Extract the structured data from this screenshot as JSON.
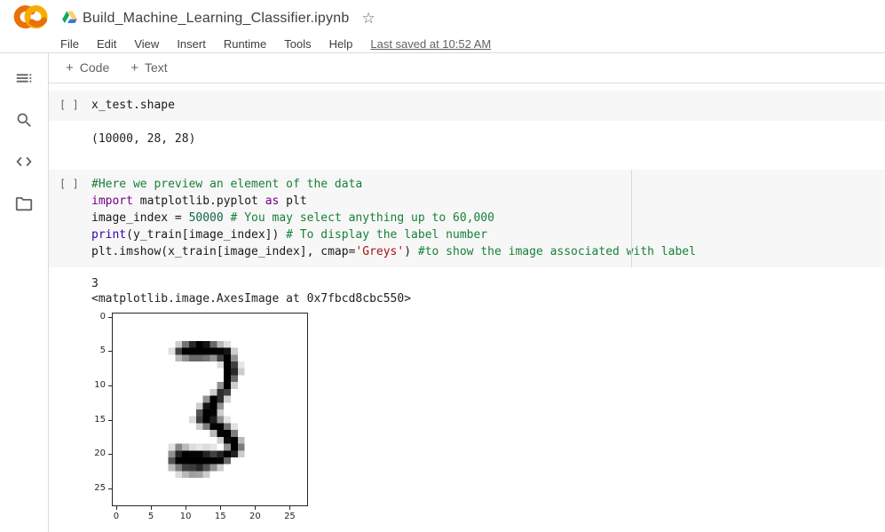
{
  "header": {
    "title": "Build_Machine_Learning_Classifier.ipynb",
    "star_icon": "☆",
    "menu_items": [
      "File",
      "Edit",
      "View",
      "Insert",
      "Runtime",
      "Tools",
      "Help"
    ],
    "last_saved": "Last saved at 10:52 AM"
  },
  "toolbar": {
    "add_code_label": "Code",
    "add_text_label": "Text",
    "plus": "+"
  },
  "sidebar": {
    "icons": [
      "table-of-contents-icon",
      "search-icon",
      "code-snippets-icon",
      "files-icon"
    ]
  },
  "cells": [
    {
      "gutter": "[ ]",
      "code_lines": [
        [
          [
            "pl",
            "x_test.shape"
          ]
        ]
      ],
      "output_lines": [
        "(10000, 28, 28)"
      ]
    },
    {
      "gutter": "[ ]",
      "code_lines": [
        [
          [
            "com",
            "#Here we preview an element of the data"
          ]
        ],
        [
          [
            "kw",
            "import"
          ],
          [
            "pl",
            " matplotlib.pyplot "
          ],
          [
            "kw",
            "as"
          ],
          [
            "pl",
            " plt"
          ]
        ],
        [
          [
            "pl",
            "image_index = "
          ],
          [
            "num",
            "50000"
          ],
          [
            "pl",
            " "
          ],
          [
            "com",
            "# You may select anything up to 60,000"
          ]
        ],
        [
          [
            "blt",
            "print"
          ],
          [
            "pl",
            "(y_train[image_index]) "
          ],
          [
            "com",
            "# To display the label number"
          ]
        ],
        [
          [
            "pl",
            "plt.imshow(x_train[image_index], cmap="
          ],
          [
            "str",
            "'Greys'"
          ],
          [
            "pl",
            ") "
          ],
          [
            "com",
            "#to show the image associated with label"
          ]
        ]
      ],
      "output_lines": [
        "3",
        "<matplotlib.image.AxesImage at 0x7fbcd8cbc550>"
      ]
    }
  ],
  "chart_data": {
    "type": "heatmap",
    "title": "",
    "xlabel": "",
    "ylabel": "",
    "colormap": "Greys",
    "x_ticks": [
      0,
      5,
      10,
      15,
      20,
      25
    ],
    "y_ticks": [
      0,
      5,
      10,
      15,
      20,
      25
    ],
    "xlim": [
      -0.5,
      27.5
    ],
    "ylim": [
      27.5,
      -0.5
    ],
    "description": "28x28 MNIST digit with label 3; values are darkness 0-255",
    "grid": [
      [
        0,
        0,
        0,
        0,
        0,
        0,
        0,
        0,
        0,
        0,
        0,
        0,
        0,
        0,
        0,
        0,
        0,
        0,
        0,
        0,
        0,
        0,
        0,
        0,
        0,
        0,
        0,
        0
      ],
      [
        0,
        0,
        0,
        0,
        0,
        0,
        0,
        0,
        0,
        0,
        0,
        0,
        0,
        0,
        0,
        0,
        0,
        0,
        0,
        0,
        0,
        0,
        0,
        0,
        0,
        0,
        0,
        0
      ],
      [
        0,
        0,
        0,
        0,
        0,
        0,
        0,
        0,
        0,
        0,
        0,
        0,
        0,
        0,
        0,
        0,
        0,
        0,
        0,
        0,
        0,
        0,
        0,
        0,
        0,
        0,
        0,
        0
      ],
      [
        0,
        0,
        0,
        0,
        0,
        0,
        0,
        0,
        0,
        0,
        0,
        0,
        0,
        0,
        0,
        0,
        0,
        0,
        0,
        0,
        0,
        0,
        0,
        0,
        0,
        0,
        0,
        0
      ],
      [
        0,
        0,
        0,
        0,
        0,
        0,
        0,
        0,
        0,
        50,
        140,
        215,
        255,
        235,
        150,
        70,
        30,
        0,
        0,
        0,
        0,
        0,
        0,
        0,
        0,
        0,
        0,
        0
      ],
      [
        0,
        0,
        0,
        0,
        0,
        0,
        0,
        0,
        30,
        190,
        255,
        255,
        255,
        255,
        255,
        250,
        235,
        50,
        0,
        0,
        0,
        0,
        0,
        0,
        0,
        0,
        0,
        0
      ],
      [
        0,
        0,
        0,
        0,
        0,
        0,
        0,
        0,
        0,
        70,
        110,
        150,
        150,
        140,
        110,
        190,
        255,
        110,
        0,
        0,
        0,
        0,
        0,
        0,
        0,
        0,
        0,
        0
      ],
      [
        0,
        0,
        0,
        0,
        0,
        0,
        0,
        0,
        0,
        0,
        0,
        0,
        0,
        0,
        0,
        35,
        255,
        190,
        25,
        0,
        0,
        0,
        0,
        0,
        0,
        0,
        0,
        0
      ],
      [
        0,
        0,
        0,
        0,
        0,
        0,
        0,
        0,
        0,
        0,
        0,
        0,
        0,
        0,
        0,
        0,
        255,
        215,
        50,
        0,
        0,
        0,
        0,
        0,
        0,
        0,
        0,
        0
      ],
      [
        0,
        0,
        0,
        0,
        0,
        0,
        0,
        0,
        0,
        0,
        0,
        0,
        0,
        0,
        0,
        0,
        255,
        150,
        0,
        0,
        0,
        0,
        0,
        0,
        0,
        0,
        0,
        0
      ],
      [
        0,
        0,
        0,
        0,
        0,
        0,
        0,
        0,
        0,
        0,
        0,
        0,
        0,
        0,
        0,
        110,
        255,
        50,
        0,
        0,
        0,
        0,
        0,
        0,
        0,
        0,
        0,
        0
      ],
      [
        0,
        0,
        0,
        0,
        0,
        0,
        0,
        0,
        0,
        0,
        0,
        0,
        0,
        0,
        50,
        210,
        190,
        0,
        0,
        0,
        0,
        0,
        0,
        0,
        0,
        0,
        0,
        0
      ],
      [
        0,
        0,
        0,
        0,
        0,
        0,
        0,
        0,
        0,
        0,
        0,
        0,
        0,
        110,
        255,
        210,
        45,
        0,
        0,
        0,
        0,
        0,
        0,
        0,
        0,
        0,
        0,
        0
      ],
      [
        0,
        0,
        0,
        0,
        0,
        0,
        0,
        0,
        0,
        0,
        0,
        0,
        50,
        235,
        255,
        110,
        0,
        0,
        0,
        0,
        0,
        0,
        0,
        0,
        0,
        0,
        0,
        0
      ],
      [
        0,
        0,
        0,
        0,
        0,
        0,
        0,
        0,
        0,
        0,
        0,
        0,
        170,
        255,
        250,
        50,
        0,
        0,
        0,
        0,
        0,
        0,
        0,
        0,
        0,
        0,
        0,
        0
      ],
      [
        0,
        0,
        0,
        0,
        0,
        0,
        0,
        0,
        0,
        0,
        0,
        35,
        190,
        255,
        225,
        110,
        25,
        0,
        0,
        0,
        0,
        0,
        0,
        0,
        0,
        0,
        0,
        0
      ],
      [
        0,
        0,
        0,
        0,
        0,
        0,
        0,
        0,
        0,
        0,
        0,
        0,
        50,
        130,
        250,
        255,
        140,
        30,
        0,
        0,
        0,
        0,
        0,
        0,
        0,
        0,
        0,
        0
      ],
      [
        0,
        0,
        0,
        0,
        0,
        0,
        0,
        0,
        0,
        0,
        0,
        0,
        0,
        0,
        70,
        250,
        255,
        130,
        0,
        0,
        0,
        0,
        0,
        0,
        0,
        0,
        0,
        0
      ],
      [
        0,
        0,
        0,
        0,
        0,
        0,
        0,
        0,
        0,
        0,
        0,
        0,
        0,
        0,
        0,
        50,
        245,
        255,
        70,
        0,
        0,
        0,
        0,
        0,
        0,
        0,
        0,
        0
      ],
      [
        0,
        0,
        0,
        0,
        0,
        0,
        0,
        0,
        30,
        120,
        70,
        35,
        25,
        35,
        25,
        0,
        110,
        255,
        130,
        0,
        0,
        0,
        0,
        0,
        0,
        0,
        0,
        0
      ],
      [
        0,
        0,
        0,
        0,
        0,
        0,
        0,
        0,
        110,
        220,
        255,
        250,
        250,
        220,
        190,
        220,
        255,
        220,
        50,
        0,
        0,
        0,
        0,
        0,
        0,
        0,
        0,
        0
      ],
      [
        0,
        0,
        0,
        0,
        0,
        0,
        0,
        0,
        170,
        255,
        255,
        255,
        255,
        255,
        255,
        250,
        150,
        0,
        0,
        0,
        0,
        0,
        0,
        0,
        0,
        0,
        0,
        0
      ],
      [
        0,
        0,
        0,
        0,
        0,
        0,
        0,
        0,
        70,
        130,
        190,
        195,
        215,
        170,
        110,
        50,
        0,
        0,
        0,
        0,
        0,
        0,
        0,
        0,
        0,
        0,
        0,
        0
      ],
      [
        0,
        0,
        0,
        0,
        0,
        0,
        0,
        0,
        0,
        35,
        70,
        95,
        90,
        50,
        0,
        0,
        0,
        0,
        0,
        0,
        0,
        0,
        0,
        0,
        0,
        0,
        0,
        0
      ],
      [
        0,
        0,
        0,
        0,
        0,
        0,
        0,
        0,
        0,
        0,
        0,
        0,
        0,
        0,
        0,
        0,
        0,
        0,
        0,
        0,
        0,
        0,
        0,
        0,
        0,
        0,
        0,
        0
      ],
      [
        0,
        0,
        0,
        0,
        0,
        0,
        0,
        0,
        0,
        0,
        0,
        0,
        0,
        0,
        0,
        0,
        0,
        0,
        0,
        0,
        0,
        0,
        0,
        0,
        0,
        0,
        0,
        0
      ],
      [
        0,
        0,
        0,
        0,
        0,
        0,
        0,
        0,
        0,
        0,
        0,
        0,
        0,
        0,
        0,
        0,
        0,
        0,
        0,
        0,
        0,
        0,
        0,
        0,
        0,
        0,
        0,
        0
      ],
      [
        0,
        0,
        0,
        0,
        0,
        0,
        0,
        0,
        0,
        0,
        0,
        0,
        0,
        0,
        0,
        0,
        0,
        0,
        0,
        0,
        0,
        0,
        0,
        0,
        0,
        0,
        0,
        0
      ]
    ]
  },
  "colors": {
    "divider": "#dadce0",
    "cell_bg": "#f7f7f7",
    "comment": "#188038",
    "keyword": "#770088",
    "number": "#116644",
    "string": "#aa1111",
    "builtin": "#3300aa",
    "logo_orange_dark": "#E8710A",
    "logo_orange_light": "#F9AB00",
    "drive_green": "#11A861",
    "drive_yellow": "#FFCF63",
    "drive_blue": "#3777E3"
  }
}
